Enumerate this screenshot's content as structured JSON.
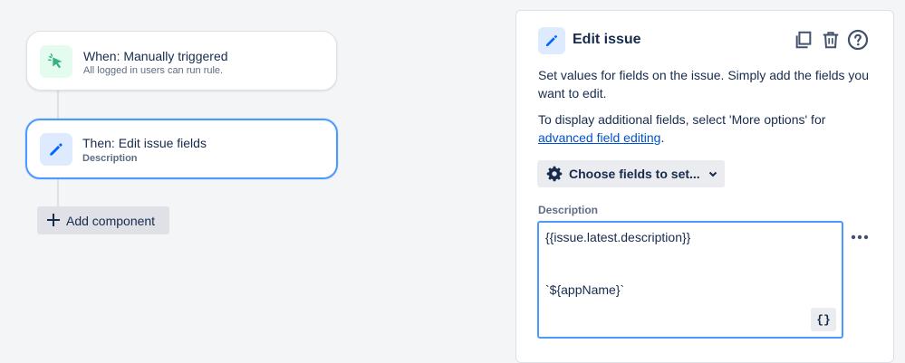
{
  "rule": {
    "trigger": {
      "title": "When: Manually triggered",
      "subtitle": "All logged in users can run rule.",
      "icon": "cursor-click-icon"
    },
    "action": {
      "title": "Then: Edit issue fields",
      "subtitle": "Description",
      "icon": "pencil-icon"
    },
    "add_component_label": "Add component"
  },
  "panel": {
    "title": "Edit issue",
    "icon": "pencil-icon",
    "header_actions": [
      "copy-icon",
      "trash-icon",
      "help-icon"
    ],
    "intro": "Set values for fields on the issue. Simply add the fields you want to edit.",
    "more_prefix": "To display additional fields, select 'More options' for",
    "more_link": "advanced field editing",
    "more_suffix": ".",
    "choose_fields_label": "Choose fields to set...",
    "field": {
      "label": "Description",
      "lines": [
        "{{issue.latest.description}}",
        "",
        "",
        "`${appName}`"
      ],
      "smart_values_button": "{}"
    }
  },
  "colors": {
    "accent": "#4c9aff",
    "trigger_icon_bg": "#e3fcef",
    "trigger_icon": "#36b37e",
    "action_icon_bg": "#deebff",
    "action_icon": "#0065ff"
  }
}
